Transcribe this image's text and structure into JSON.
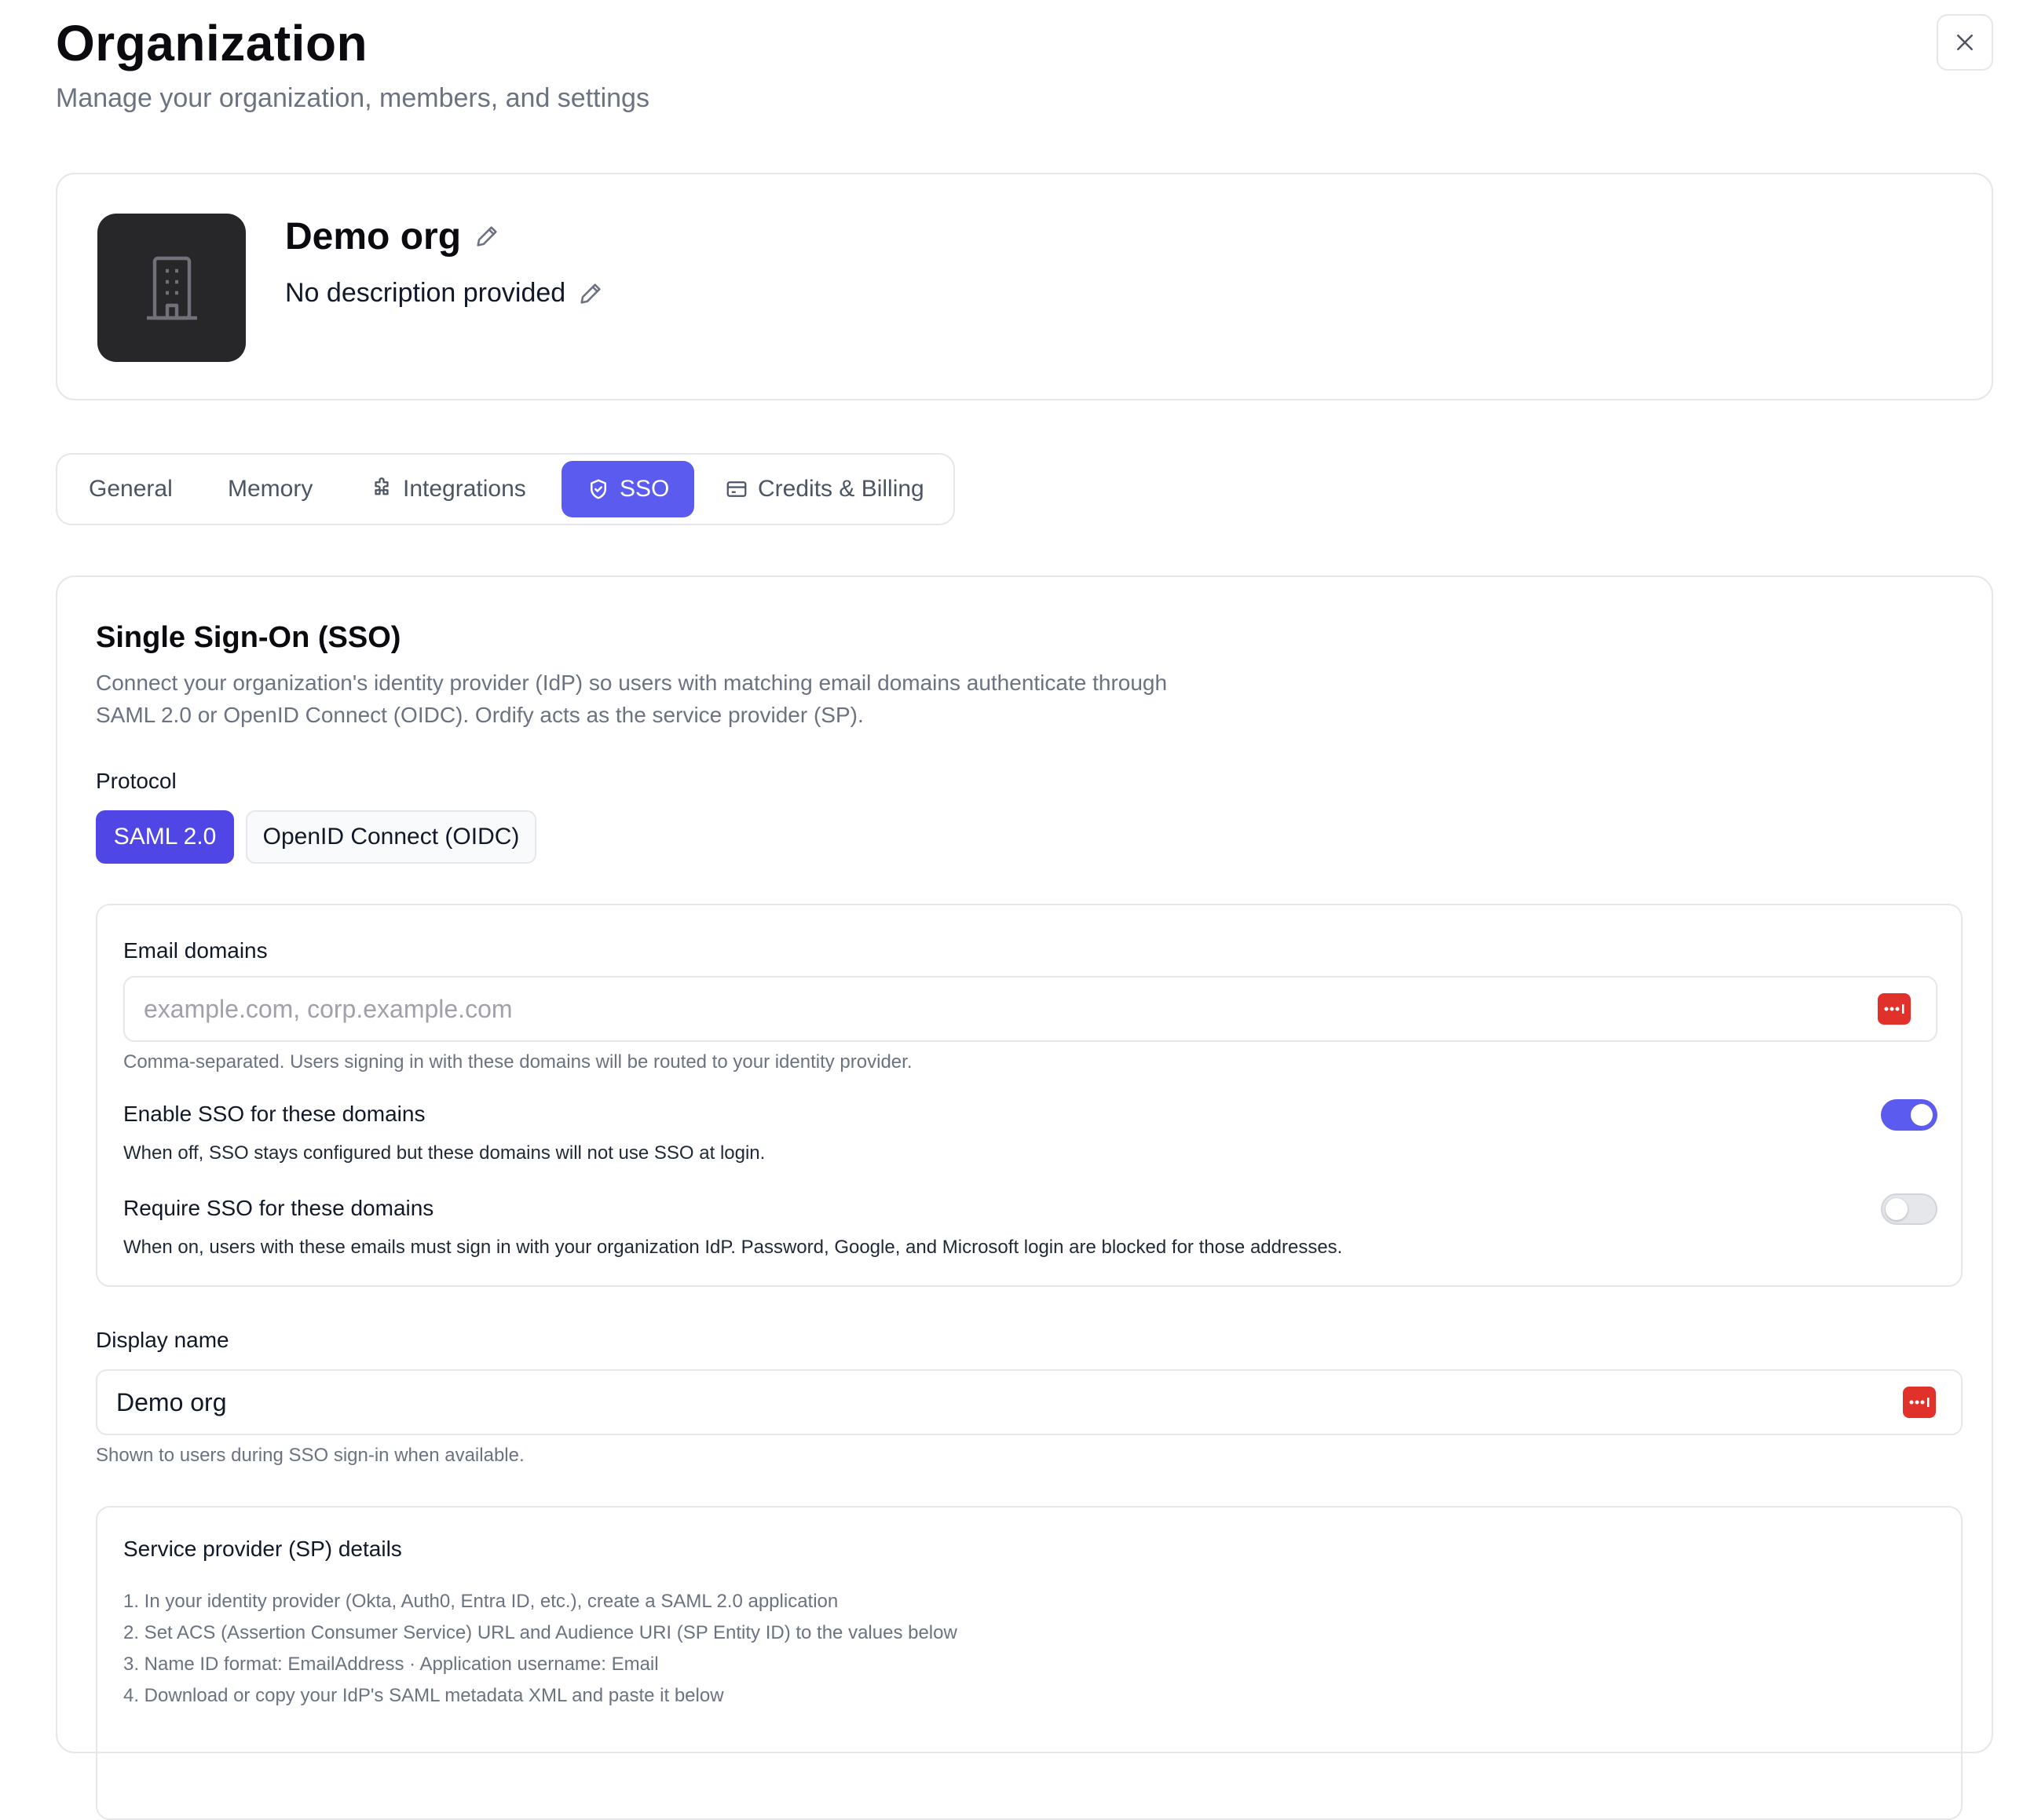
{
  "header": {
    "title": "Organization",
    "subtitle": "Manage your organization, members, and settings"
  },
  "org": {
    "name": "Demo org",
    "description": "No description provided"
  },
  "tabs": [
    {
      "label": "General",
      "icon": null
    },
    {
      "label": "Memory",
      "icon": null
    },
    {
      "label": "Integrations",
      "icon": "puzzle-icon"
    },
    {
      "label": "SSO",
      "icon": "shield-check-icon",
      "active": true
    },
    {
      "label": "Credits & Billing",
      "icon": "credit-card-icon"
    }
  ],
  "sso": {
    "title": "Single Sign-On (SSO)",
    "description": "Connect your organization's identity provider (IdP) so users with matching email domains authenticate through SAML 2.0 or OpenID Connect (OIDC). Ordify acts as the service provider (SP).",
    "protocol_label": "Protocol",
    "protocols": [
      {
        "label": "SAML 2.0",
        "selected": true
      },
      {
        "label": "OpenID Connect (OIDC)",
        "selected": false
      }
    ],
    "email_domains": {
      "label": "Email domains",
      "value": "",
      "placeholder": "example.com, corp.example.com",
      "hint": "Comma-separated. Users signing in with these domains will be routed to your identity provider."
    },
    "enable_sso": {
      "label": "Enable SSO for these domains",
      "hint": "When off, SSO stays configured but these domains will not use SSO at login.",
      "on": true
    },
    "require_sso": {
      "label": "Require SSO for these domains",
      "hint": "When on, users with these emails must sign in with your organization IdP. Password, Google, and Microsoft login are blocked for those addresses.",
      "on": false
    },
    "display_name": {
      "label": "Display name",
      "value": "Demo org",
      "hint": "Shown to users during SSO sign-in when available."
    },
    "sp_details": {
      "title": "Service provider (SP) details",
      "steps": [
        "1. In your identity provider (Okta, Auth0, Entra ID, etc.), create a SAML 2.0 application",
        "2. Set ACS (Assertion Consumer Service) URL and Audience URI (SP Entity ID) to the values below",
        "3. Name ID format: EmailAddress · Application username: Email",
        "4. Download or copy your IdP's SAML metadata XML and paste it below"
      ]
    }
  },
  "colors": {
    "accent": "#5b5bf0",
    "protocol_active": "#4f46e5",
    "password_manager": "#e0322b",
    "avatar_bg": "#27272a"
  }
}
